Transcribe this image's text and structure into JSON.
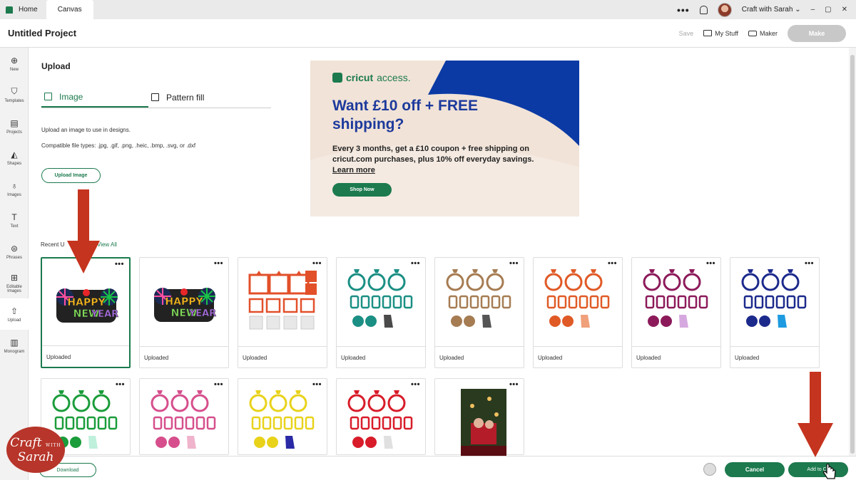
{
  "tabbar": {
    "home_label": "Home",
    "canvas_label": "Canvas",
    "more": "•••",
    "user_name": "Craft with Sarah",
    "minimize": "–",
    "maximize": "▢",
    "close": "✕"
  },
  "header": {
    "title": "Untitled Project",
    "save": "Save",
    "my_stuff": "My Stuff",
    "maker": "Maker",
    "make": "Make"
  },
  "sidebar": {
    "items": [
      {
        "label": "New",
        "icon": "plus-circle-icon"
      },
      {
        "label": "Templates",
        "icon": "tshirt-icon"
      },
      {
        "label": "Projects",
        "icon": "projects-icon"
      },
      {
        "label": "Shapes",
        "icon": "shapes-icon"
      },
      {
        "label": "Images",
        "icon": "lightbulb-icon"
      },
      {
        "label": "Text",
        "icon": "text-icon"
      },
      {
        "label": "Phrases",
        "icon": "speech-bubble-icon"
      },
      {
        "label": "Editable Images",
        "icon": "editable-images-icon"
      },
      {
        "label": "Upload",
        "icon": "upload-icon"
      },
      {
        "label": "Monogram",
        "icon": "monogram-icon"
      }
    ]
  },
  "panel": {
    "title": "Upload",
    "tabs": [
      {
        "label": "Image",
        "icon": "image-icon"
      },
      {
        "label": "Pattern fill",
        "icon": "pattern-icon"
      }
    ],
    "desc1": "Upload an image to use in designs.",
    "desc2": "Compatible file types: .jpg, .gif, .png, .heic, .bmp, .svg, or .dxf",
    "upload_button": "Upload Image",
    "recent_label": "Recent U",
    "view_all": "View All"
  },
  "ad": {
    "brand": "cricut",
    "brand_suffix": "access.",
    "headline": "Want £10 off + FREE shipping?",
    "body": "Every 3 months, get a £10 coupon + free shipping on cricut.com purchases, plus 10% off everyday savings.",
    "learn_more": "Learn more",
    "cta": "Shop Now",
    "colors": {
      "bg": "#f1e3d7",
      "blue": "#0b3aa5",
      "white": "#ffffff"
    }
  },
  "cards": [
    {
      "label": "Uploaded",
      "kind": "new-year",
      "selected": true
    },
    {
      "label": "Uploaded",
      "kind": "new-year",
      "selected": false
    },
    {
      "label": "Uploaded",
      "kind": "template-red",
      "color": "#e2502a"
    },
    {
      "label": "Uploaded",
      "kind": "lanterns",
      "color": "#1b8f84",
      "accent": "#4a4a4a"
    },
    {
      "label": "Uploaded",
      "kind": "lanterns",
      "color": "#a67c52",
      "accent": "#555555"
    },
    {
      "label": "Uploaded",
      "kind": "lanterns",
      "color": "#e05a26",
      "accent": "#f0a07a"
    },
    {
      "label": "Uploaded",
      "kind": "lanterns",
      "color": "#8c1a5a",
      "accent": "#d6a8e0"
    },
    {
      "label": "Uploaded",
      "kind": "lanterns",
      "color": "#1c2a8c",
      "accent": "#1e9be0"
    },
    {
      "kind": "lanterns",
      "color": "#1a9c3a",
      "accent": "#bff0dc"
    },
    {
      "kind": "lanterns",
      "color": "#d64f8c",
      "accent": "#f0b3cc"
    },
    {
      "kind": "lanterns",
      "color": "#e8d21a",
      "accent": "#2a2aa6"
    },
    {
      "kind": "lanterns",
      "color": "#d81c2a",
      "accent": "#e0e0e0"
    },
    {
      "kind": "photo"
    }
  ],
  "footer": {
    "download": "Download",
    "cancel": "Cancel",
    "add_to_canvas": "Add to Ca"
  },
  "watermark": {
    "line1": "Craft",
    "with": "WITH",
    "line2": "Sarah"
  },
  "colors": {
    "accent": "#1c7a4e",
    "arrow": "#c5341e"
  }
}
